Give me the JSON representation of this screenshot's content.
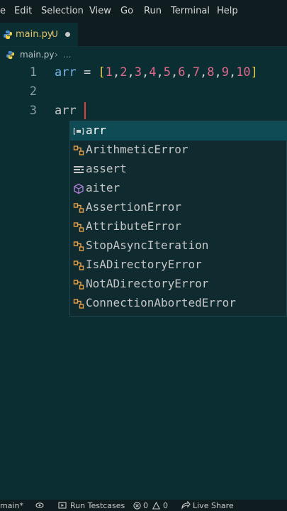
{
  "menu": [
    "e",
    "Edit",
    "Selection",
    "View",
    "Go",
    "Run",
    "Terminal",
    "Help"
  ],
  "tab": {
    "filename": "main.py",
    "status": "U"
  },
  "breadcrumb": {
    "file": "main.py",
    "sep": "›",
    "more": "..."
  },
  "editor": {
    "line_numbers": [
      "1",
      "2",
      "3"
    ],
    "line1": {
      "var": "arr",
      "eq": " = ",
      "open": "[",
      "close": "]",
      "numbers": [
        "1",
        "2",
        "3",
        "4",
        "5",
        "6",
        "7",
        "8",
        "9",
        "10"
      ]
    },
    "line3": "arr"
  },
  "suggestions": [
    {
      "label": "arr",
      "icon": "variable-icon",
      "selected": true
    },
    {
      "label": "ArithmeticError",
      "icon": "class-icon"
    },
    {
      "label": "assert",
      "icon": "keyword-icon"
    },
    {
      "label": "aiter",
      "icon": "method-icon"
    },
    {
      "label": "AssertionError",
      "icon": "class-icon"
    },
    {
      "label": "AttributeError",
      "icon": "class-icon"
    },
    {
      "label": "StopAsyncIteration",
      "icon": "class-icon"
    },
    {
      "label": "IsADirectoryError",
      "icon": "class-icon"
    },
    {
      "label": "NotADirectoryError",
      "icon": "class-icon"
    },
    {
      "label": "ConnectionAbortedError",
      "icon": "class-icon"
    }
  ],
  "statusbar": {
    "branch": "main*",
    "run": "Run Testcases",
    "errors": "0",
    "warnings": "0",
    "live_share": "Live Share"
  },
  "colors": {
    "background": "#0b2e33",
    "selection": "#0e4b55",
    "cursor": "#e53b3b",
    "modified": "#e8c36a"
  }
}
